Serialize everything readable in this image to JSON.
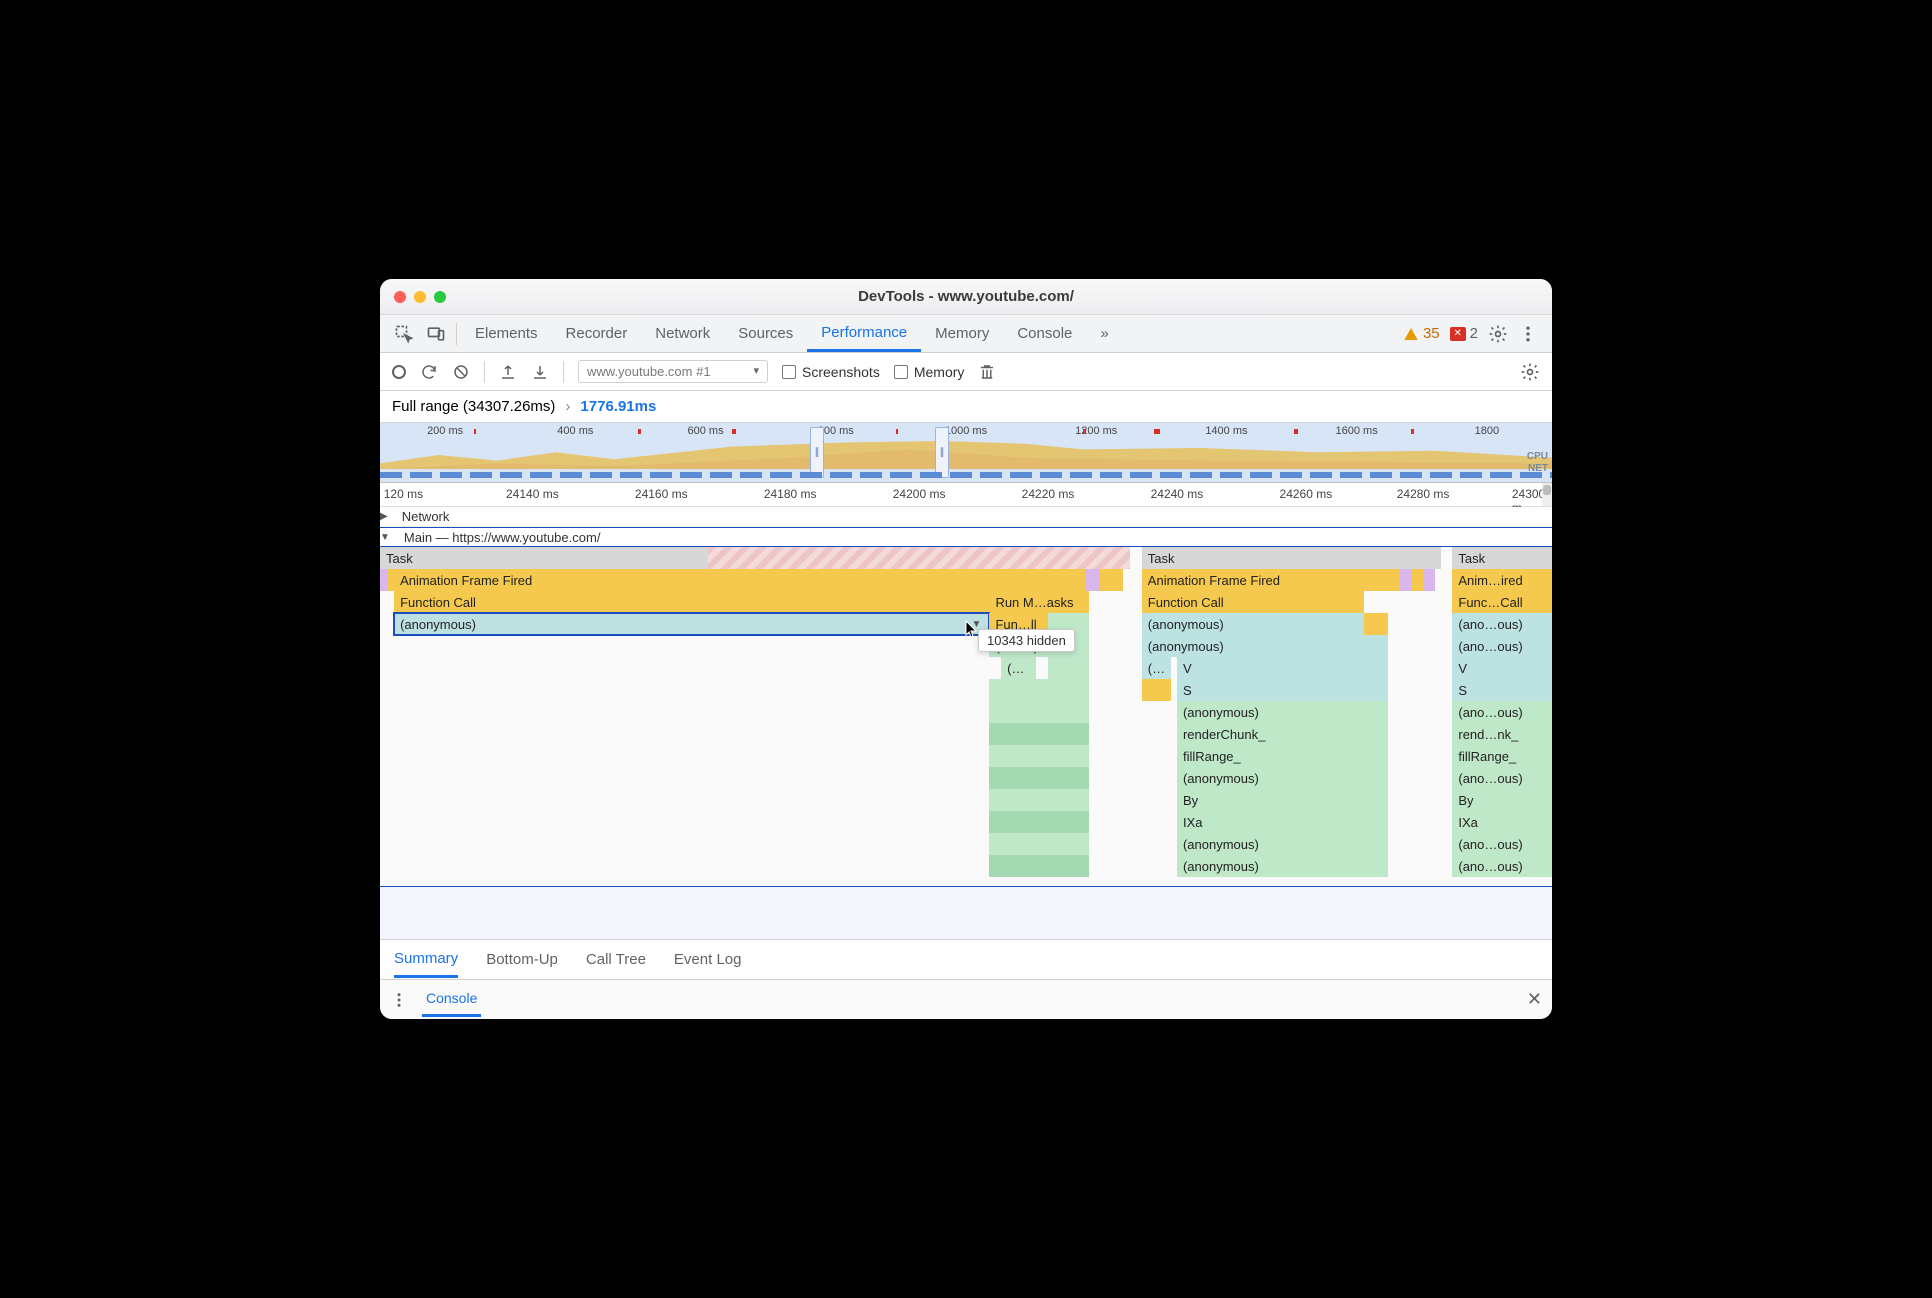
{
  "window": {
    "title": "DevTools - www.youtube.com/"
  },
  "tabs": {
    "items": [
      "Elements",
      "Recorder",
      "Network",
      "Sources",
      "Performance",
      "Memory",
      "Console"
    ],
    "active": "Performance",
    "more_glyph": "»",
    "warnings_count": "35",
    "errors_count": "2"
  },
  "toolbar": {
    "profile_select": "www.youtube.com #1",
    "screenshots_label": "Screenshots",
    "memory_label": "Memory"
  },
  "breadcrumb": {
    "full_label": "Full range (34307.26ms)",
    "selected": "1776.91ms"
  },
  "overview": {
    "ticks": [
      "200 ms",
      "400 ms",
      "600 ms",
      "800 ms",
      "1000 ms",
      "1200 ms",
      "1400 ms",
      "1600 ms",
      "1800"
    ],
    "cpu_label": "CPU",
    "net_label": "NET"
  },
  "ruler": {
    "ticks": [
      "120 ms",
      "24140 ms",
      "24160 ms",
      "24180 ms",
      "24200 ms",
      "24220 ms",
      "24240 ms",
      "24260 ms",
      "24280 ms",
      "24300 m"
    ]
  },
  "tracks": {
    "network_label": "Network",
    "main_label": "Main — https://www.youtube.com/"
  },
  "flame": {
    "col1": {
      "task": "Task",
      "aff": "Animation Frame Fired",
      "fc": "Function Call",
      "anon": "(anonymous)",
      "runm": "Run M…asks",
      "funll": "Fun…ll",
      "ans": "(an…s)",
      "paren": "(…"
    },
    "col2": {
      "task": "Task",
      "aff": "Animation Frame Fired",
      "fc": "Function Call",
      "rows": [
        "(anonymous)",
        "(anonymous)",
        "(…   V",
        "S",
        "(anonymous)",
        "renderChunk_",
        "fillRange_",
        "(anonymous)",
        "By",
        "IXa",
        "(anonymous)",
        "(anonymous)"
      ]
    },
    "col3": {
      "task": "Task",
      "aff": "Anim…ired",
      "fc": "Func…Call",
      "rows": [
        "(ano…ous)",
        "(ano…ous)",
        "V",
        "S",
        "(ano…ous)",
        "rend…nk_",
        "fillRange_",
        "(ano…ous)",
        "By",
        "IXa",
        "(ano…ous)",
        "(ano…ous)"
      ]
    },
    "tooltip": "10343 hidden"
  },
  "bottom_tabs": {
    "items": [
      "Summary",
      "Bottom-Up",
      "Call Tree",
      "Event Log"
    ],
    "active": "Summary"
  },
  "drawer": {
    "label": "Console"
  }
}
